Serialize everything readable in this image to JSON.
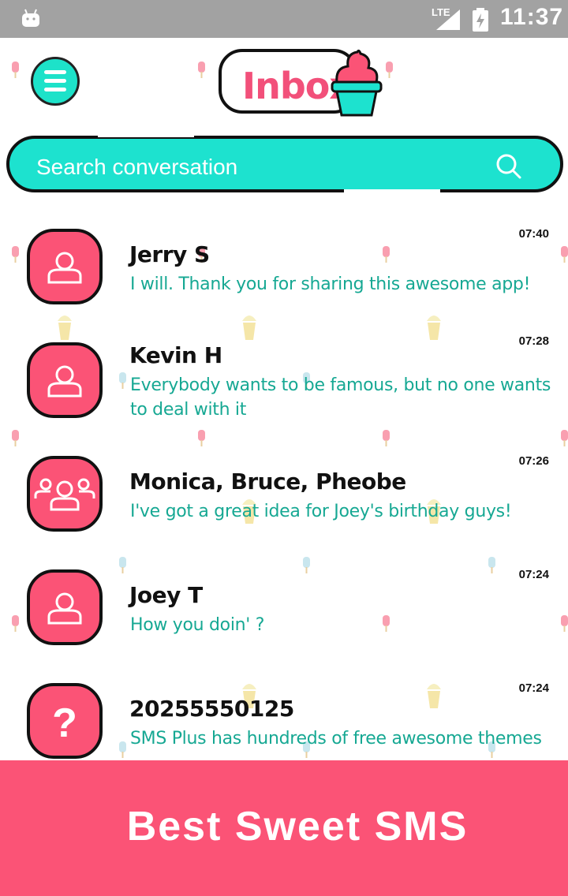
{
  "status_bar": {
    "network": "LTE",
    "time": "11:37"
  },
  "header": {
    "title": "Inbox",
    "menu_icon": "hamburger-menu-icon",
    "logo_icon": "ice-cream-cup-icon"
  },
  "search": {
    "placeholder": "Search conversation",
    "icon": "search-icon"
  },
  "conversations": [
    {
      "name": "Jerry S",
      "message": "I will. Thank you for sharing this awesome app!",
      "time": "07:40",
      "avatar": "person-icon"
    },
    {
      "name": "Kevin H",
      "message": "Everybody wants to be famous, but no one wants to deal with it",
      "time": "07:28",
      "avatar": "person-icon"
    },
    {
      "name": "Monica, Bruce, Pheobe",
      "message": "I've got a great idea for Joey's birthday guys!",
      "time": "07:26",
      "avatar": "group-icon"
    },
    {
      "name": "Joey T",
      "message": "How you doin' ?",
      "time": "07:24",
      "avatar": "person-icon"
    },
    {
      "name": "20255550125",
      "message": "SMS Plus has hundreds of free awesome themes",
      "time": "07:24",
      "avatar": "question-mark-icon"
    }
  ],
  "banner": {
    "text": "Best Sweet SMS"
  },
  "colors": {
    "accent_teal": "#1de2cf",
    "accent_pink": "#fb5376",
    "message_text": "#16a893",
    "status_bar": "#a2a2a2"
  }
}
